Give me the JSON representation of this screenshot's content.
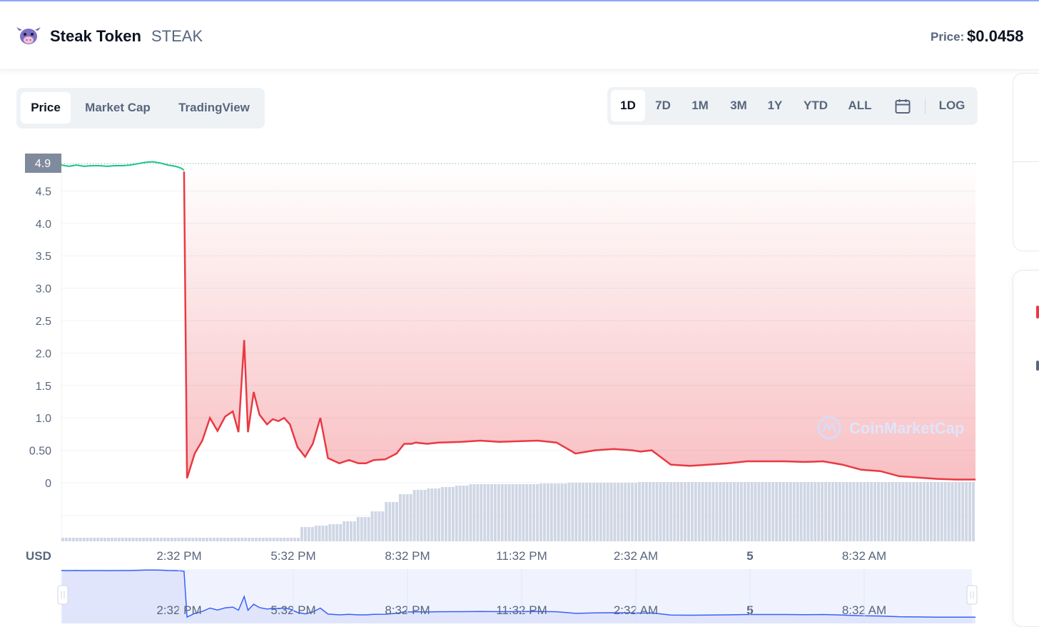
{
  "header": {
    "coin_name": "Steak Token",
    "coin_symbol": "STEAK",
    "price_label": "Price:",
    "price_value": "$0.0458"
  },
  "chart_tabs": [
    "Price",
    "Market Cap",
    "TradingView"
  ],
  "chart_tabs_active": "Price",
  "ranges": [
    "1D",
    "7D",
    "1M",
    "3M",
    "1Y",
    "YTD",
    "ALL"
  ],
  "range_active": "1D",
  "log_label": "LOG",
  "icons": {
    "logo": "cow-logo-icon",
    "calendar": "calendar-icon",
    "watermark": "coinmarketcap-logo-icon"
  },
  "colors": {
    "up": "#16c784",
    "down": "#ea3943",
    "volume": "#cfd6e4",
    "navigator_line": "#3861fb",
    "accent": "#3861fb"
  },
  "chart_data": {
    "type": "line",
    "y_axis_unit": "USD",
    "current_price_marker": "4.9",
    "y_ticks": [
      "0",
      "0.50",
      "1.0",
      "1.5",
      "2.0",
      "2.5",
      "3.0",
      "3.5",
      "4.0",
      "4.5"
    ],
    "ylim": [
      0,
      5
    ],
    "x_ticks": [
      "2:32 PM",
      "5:32 PM",
      "8:32 PM",
      "11:32 PM",
      "2:32 AM",
      "5",
      "8:32 AM"
    ],
    "watermark": "CoinMarketCap",
    "series": [
      {
        "x_hours": [
          0,
          0.2,
          0.4,
          0.6,
          0.8,
          1.0,
          1.2,
          1.4,
          1.6,
          1.8,
          2.0,
          2.2,
          2.4,
          2.6,
          2.8,
          3.0,
          3.15,
          3.22
        ],
        "values": [
          4.9,
          4.88,
          4.9,
          4.88,
          4.89,
          4.89,
          4.88,
          4.89,
          4.89,
          4.9,
          4.92,
          4.94,
          4.95,
          4.93,
          4.9,
          4.88,
          4.85,
          4.82
        ]
      },
      {
        "x_hours": [
          3.22,
          3.3,
          3.5,
          3.7,
          3.9,
          4.1,
          4.3,
          4.5,
          4.65,
          4.8,
          4.9,
          5.05,
          5.2,
          5.4,
          5.55,
          5.7,
          5.85,
          6.0,
          6.2,
          6.4,
          6.6,
          6.8,
          7.0,
          7.3,
          7.55,
          7.8,
          8.0,
          8.2,
          8.5,
          8.8,
          9.0,
          9.2,
          9.3,
          9.6,
          9.9,
          10.5,
          11.0,
          11.5,
          12.0,
          12.5,
          13.0,
          13.5,
          14.0,
          14.5,
          15.0,
          15.2,
          15.5,
          16.0,
          16.5,
          17.0,
          17.5,
          18.0,
          18.3,
          18.5,
          19.0,
          19.5,
          20.0,
          20.5,
          21.0,
          21.5,
          22.0,
          22.5,
          23.0,
          23.5,
          24.0
        ],
        "values": [
          4.8,
          0.07,
          0.45,
          0.65,
          1.0,
          0.8,
          1.02,
          1.1,
          0.78,
          2.2,
          0.78,
          1.4,
          1.05,
          0.9,
          0.98,
          0.95,
          1.0,
          0.9,
          0.55,
          0.4,
          0.6,
          1.0,
          0.38,
          0.3,
          0.35,
          0.3,
          0.3,
          0.35,
          0.36,
          0.45,
          0.6,
          0.6,
          0.62,
          0.6,
          0.62,
          0.63,
          0.65,
          0.63,
          0.64,
          0.65,
          0.62,
          0.45,
          0.5,
          0.52,
          0.5,
          0.48,
          0.5,
          0.28,
          0.26,
          0.28,
          0.3,
          0.33,
          0.33,
          0.33,
          0.33,
          0.32,
          0.33,
          0.28,
          0.2,
          0.18,
          0.1,
          0.08,
          0.06,
          0.05,
          0.05
        ]
      }
    ],
    "volume": [
      0.05,
      0.05,
      0.05,
      0.05,
      0.05,
      0.05,
      0.05,
      0.05,
      0.05,
      0.05,
      0.05,
      0.05,
      0.05,
      0.05,
      0.05,
      0.05,
      0.05,
      0.2,
      0.22,
      0.24,
      0.28,
      0.34,
      0.42,
      0.55,
      0.66,
      0.72,
      0.74,
      0.76,
      0.78,
      0.8,
      0.8,
      0.8,
      0.8,
      0.8,
      0.81,
      0.81,
      0.82,
      0.82,
      0.82,
      0.82,
      0.82,
      0.83,
      0.83,
      0.83,
      0.83,
      0.83,
      0.83,
      0.83,
      0.83,
      0.83,
      0.83,
      0.83,
      0.83,
      0.83,
      0.83,
      0.83,
      0.83,
      0.83,
      0.83,
      0.83,
      0.83,
      0.83,
      0.83,
      0.83,
      0.83
    ]
  }
}
